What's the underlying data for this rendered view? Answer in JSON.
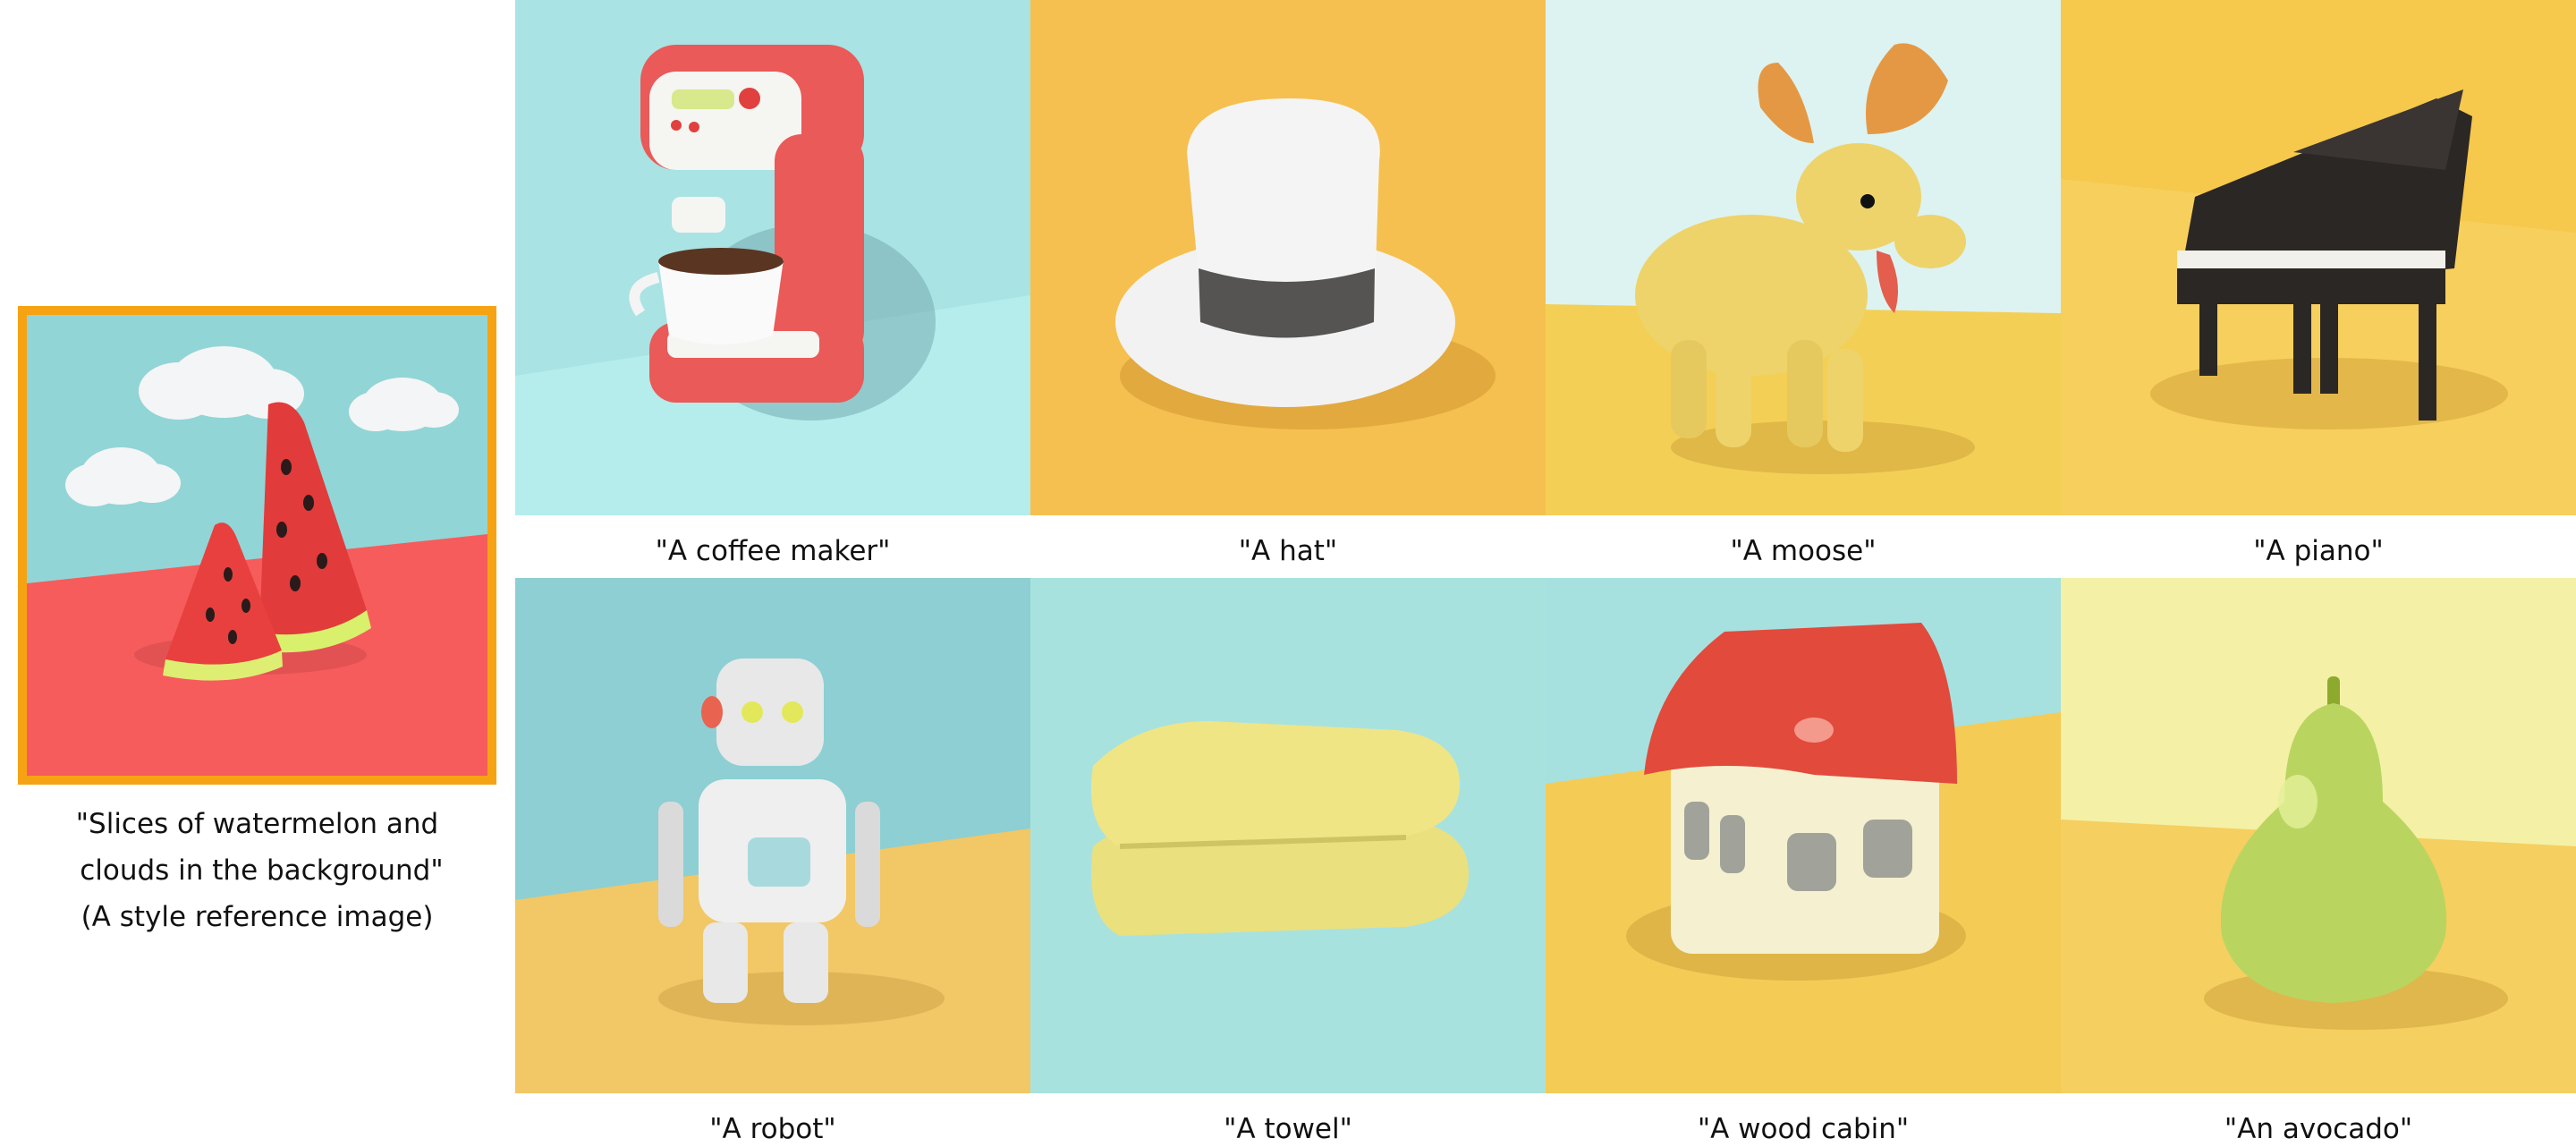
{
  "style_reference": {
    "caption_lines": [
      "\"Slices of watermelon and",
      " clouds in the background\"",
      "(A style reference image)"
    ],
    "frame_color": "#F6A313",
    "subject": "watermelon-slices-with-clouds"
  },
  "grid": [
    {
      "caption": "\"A coffee maker\"",
      "icon": "coffee-maker-icon",
      "bg": "#A9E3E4",
      "floor": "#B5ECEC"
    },
    {
      "caption": "\"A hat\"",
      "icon": "hat-icon",
      "bg": "#F5C04F",
      "floor": "#F6C65A"
    },
    {
      "caption": "\"A moose\"",
      "icon": "moose-icon",
      "bg": "#DDF3F1",
      "floor": "#F4CF55"
    },
    {
      "caption": "\"A piano\"",
      "icon": "piano-icon",
      "bg": "#F6C84C",
      "floor": "#F7CF5D"
    },
    {
      "caption": "\"A robot\"",
      "icon": "robot-icon",
      "bg": "#8DCFD3",
      "floor": "#F2C765"
    },
    {
      "caption": "\"A towel\"",
      "icon": "towel-icon",
      "bg": "#A8E2DF",
      "floor": "#B0E6E0"
    },
    {
      "caption": "\"A wood cabin\"",
      "icon": "cabin-icon",
      "bg": "#A6E1E0",
      "floor": "#F4CB55"
    },
    {
      "caption": "\"An avocado\"",
      "icon": "avocado-icon",
      "bg": "#F4F0A6",
      "floor": "#F5CF5F"
    }
  ]
}
